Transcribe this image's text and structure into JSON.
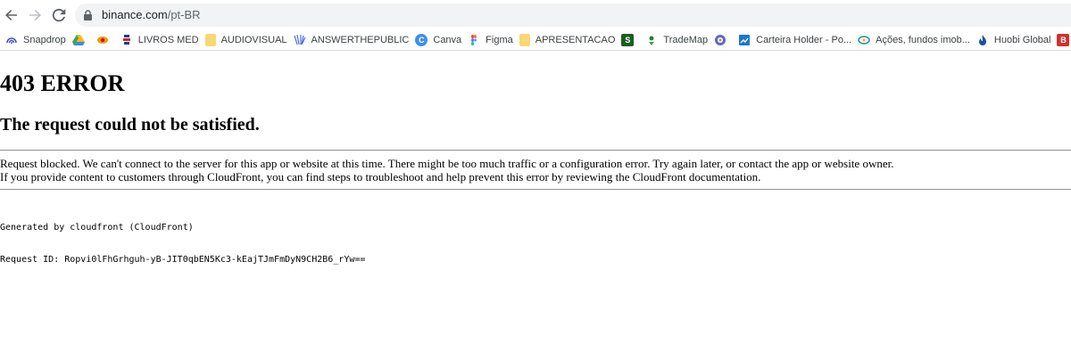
{
  "browser": {
    "url_host": "binance.com",
    "url_path": "/pt-BR",
    "bookmarks": [
      {
        "label": "Snapdrop",
        "icon": "snapdrop-icon",
        "color": "#3f51b5"
      },
      {
        "label": "",
        "icon": "google-drive-icon",
        "color": "#34a853"
      },
      {
        "label": "",
        "icon": "eye-icon",
        "color": "#e65100"
      },
      {
        "label": "LIVROS MED",
        "icon": "books-icon",
        "color": "#1e3a8a"
      },
      {
        "label": "AUDIOVISUAL",
        "icon": "folder-icon",
        "color": "#f8d775"
      },
      {
        "label": "ANSWERTHEPUBLIC",
        "icon": "answerthepublic-icon",
        "color": "#4a6ee0"
      },
      {
        "label": "Canva",
        "icon": "canva-icon",
        "color": "#3d8ff0"
      },
      {
        "label": "Figma",
        "icon": "figma-icon",
        "color": "#f24e1e"
      },
      {
        "label": "APRESENTACAO",
        "icon": "folder-icon",
        "color": "#f8d775"
      },
      {
        "label": "",
        "icon": "s-icon",
        "color": "#1b5e20"
      },
      {
        "label": "TradeMap",
        "icon": "trademap-icon",
        "color": "#2e7d32"
      },
      {
        "label": "",
        "icon": "globe-icon",
        "color": "#5c6bc0"
      },
      {
        "label": "Carteira Holder - Po...",
        "icon": "chart-icon",
        "color": "#1976d2"
      },
      {
        "label": "Ações, fundos imob...",
        "icon": "statusinvest-icon",
        "color": "#0d8a9e"
      },
      {
        "label": "Huobi Global",
        "icon": "flame-icon",
        "color": "#1a4fa0"
      },
      {
        "label": "",
        "icon": "b-icon",
        "color": "#d32f2f"
      }
    ]
  },
  "page": {
    "title": "403 ERROR",
    "subtitle": "The request could not be satisfied.",
    "message_line1": "Request blocked. We can't connect to the server for this app or website at this time. There might be too much traffic or a configuration error. Try again later, or contact the app or website owner.",
    "message_line2": "If you provide content to customers through CloudFront, you can find steps to troubleshoot and help prevent this error by reviewing the CloudFront documentation.",
    "generated_by": "Generated by cloudfront (CloudFront)",
    "request_id": "Request ID: Ropvi0lFhGrhguh-yB-JIT0qbEN5Kc3-kEajTJmFmDyN9CH2B6_rYw=="
  }
}
